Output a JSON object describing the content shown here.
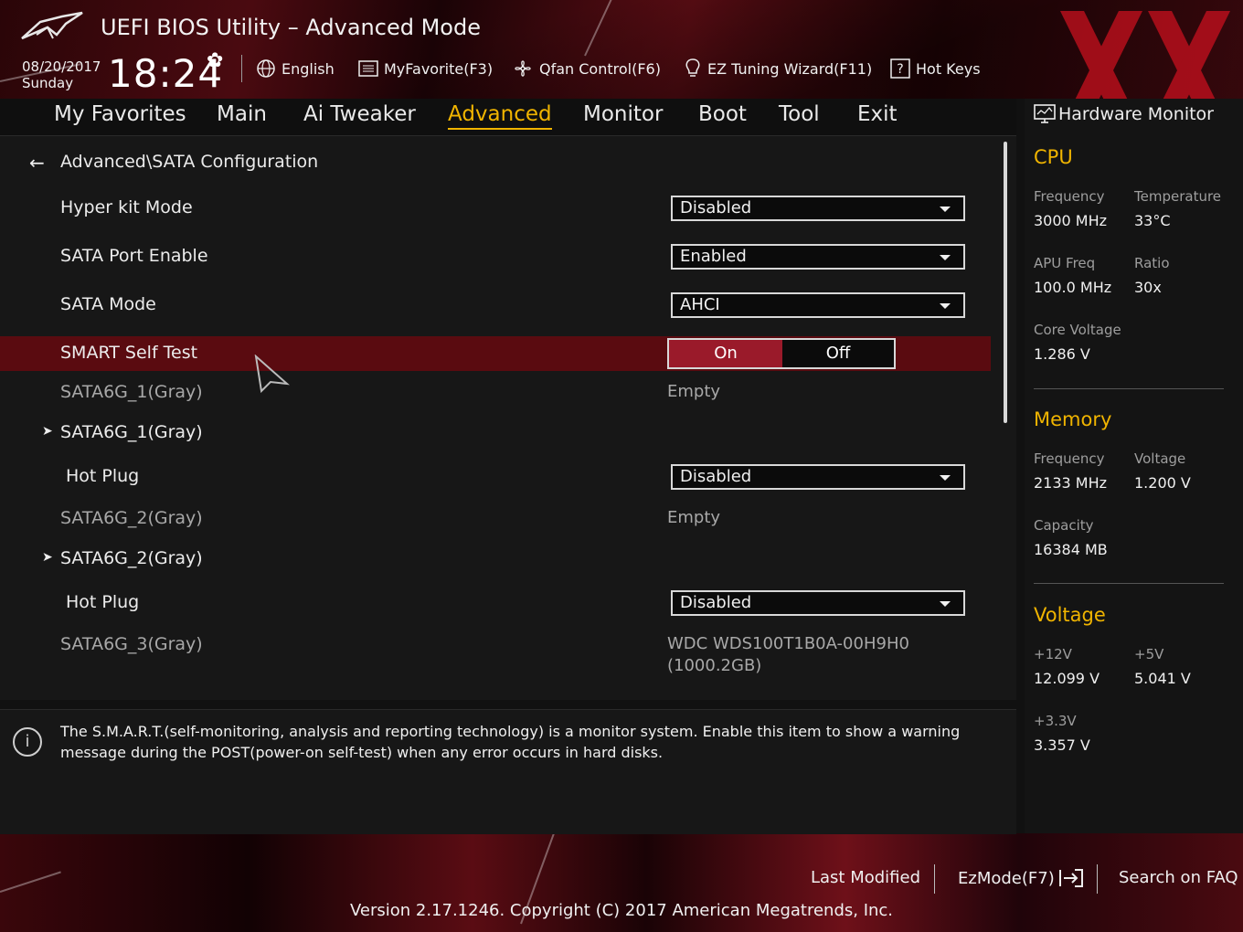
{
  "header": {
    "title": "UEFI BIOS Utility – Advanced Mode",
    "date": "08/20/2017",
    "day": "Sunday",
    "time": "18:24",
    "buttons": {
      "language": "English",
      "favorite": "MyFavorite(F3)",
      "qfan": "Qfan Control(F6)",
      "ez_tuning": "EZ Tuning Wizard(F11)",
      "hotkeys": "Hot Keys"
    }
  },
  "nav": {
    "tabs": [
      "My Favorites",
      "Main",
      "Ai Tweaker",
      "Advanced",
      "Monitor",
      "Boot",
      "Tool",
      "Exit"
    ],
    "active": "Advanced"
  },
  "main": {
    "breadcrumb": "Advanced\\SATA Configuration",
    "rows": {
      "hyper_kit": {
        "label": "Hyper kit Mode",
        "value": "Disabled"
      },
      "sata_port": {
        "label": "SATA Port Enable",
        "value": "Enabled"
      },
      "sata_mode": {
        "label": "SATA Mode",
        "value": "AHCI"
      },
      "smart": {
        "label": "SMART Self Test",
        "on": "On",
        "off": "Off",
        "selected": "On"
      },
      "sata1_info": {
        "label": "SATA6G_1(Gray)",
        "value": "Empty"
      },
      "sata1_sub": {
        "label": "SATA6G_1(Gray)"
      },
      "hot_plug_1": {
        "label": "Hot Plug",
        "value": "Disabled"
      },
      "sata2_info": {
        "label": "SATA6G_2(Gray)",
        "value": "Empty"
      },
      "sata2_sub": {
        "label": "SATA6G_2(Gray)"
      },
      "hot_plug_2": {
        "label": "Hot Plug",
        "value": "Disabled"
      },
      "sata3_info": {
        "label": "SATA6G_3(Gray)",
        "value_line1": "WDC WDS100T1B0A-00H9H0",
        "value_line2": "(1000.2GB)"
      }
    }
  },
  "info": {
    "text": "The S.M.A.R.T.(self-monitoring, analysis and reporting technology) is a monitor system. Enable this item to show a warning message during the POST(power-on self-test) when any error occurs in hard disks."
  },
  "hardware_monitor": {
    "title": "Hardware Monitor",
    "cpu": {
      "heading": "CPU",
      "frequency_label": "Frequency",
      "frequency": "3000 MHz",
      "temperature_label": "Temperature",
      "temperature": "33°C",
      "apu_label": "APU Freq",
      "apu": "100.0 MHz",
      "ratio_label": "Ratio",
      "ratio": "30x",
      "core_voltage_label": "Core Voltage",
      "core_voltage": "1.286 V"
    },
    "memory": {
      "heading": "Memory",
      "frequency_label": "Frequency",
      "frequency": "2133 MHz",
      "voltage_label": "Voltage",
      "voltage": "1.200 V",
      "capacity_label": "Capacity",
      "capacity": "16384 MB"
    },
    "voltage": {
      "heading": "Voltage",
      "v12_label": "+12V",
      "v12": "12.099 V",
      "v5_label": "+5V",
      "v5": "5.041 V",
      "v33_label": "+3.3V",
      "v33": "3.357 V"
    }
  },
  "footer": {
    "last_modified": "Last Modified",
    "ezmode": "EzMode(F7)",
    "search_faq": "Search on FAQ",
    "version": "Version 2.17.1246. Copyright (C) 2017 American Megatrends, Inc."
  },
  "colors": {
    "accent": "#f0b400",
    "highlight_row": "#5a0b10",
    "toggle_on": "#9a1a2a"
  }
}
